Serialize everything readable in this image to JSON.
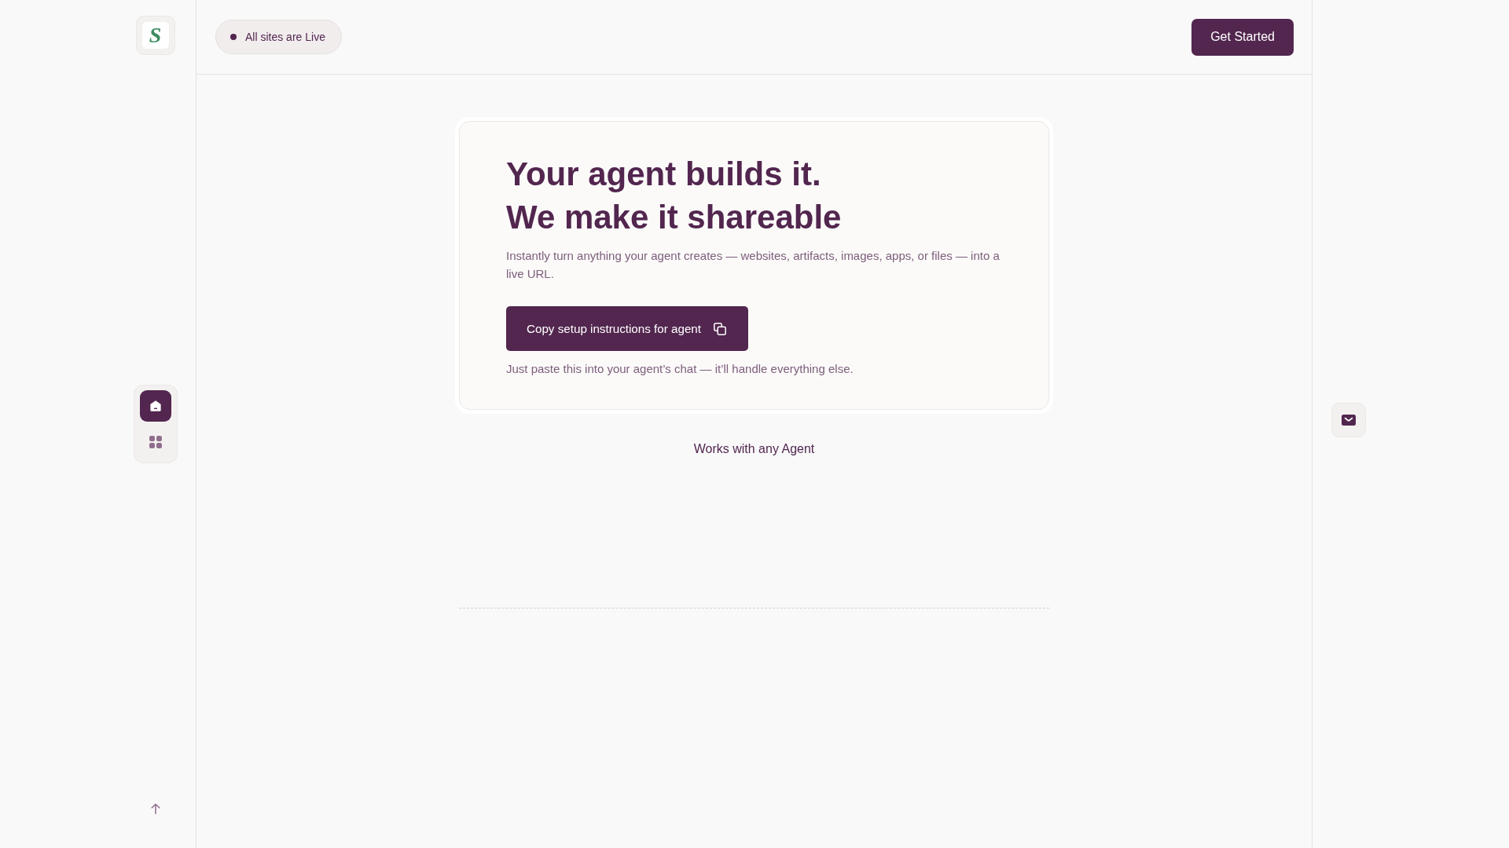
{
  "sidebar": {
    "logo": "S",
    "nav": [
      {
        "kind": "home",
        "selected": true
      },
      {
        "kind": "apps",
        "selected": false
      }
    ]
  },
  "header": {
    "status": "All sites are Live",
    "cta": "Get Started"
  },
  "hero": {
    "title_lines": [
      "Your agent builds it.",
      "We make it shareable"
    ],
    "description": "Instantly turn anything your agent creates — websites, artifacts, images, apps, or files — into a live URL.",
    "action": "Copy setup instructions for agent",
    "note": "Just paste this into your agent’s chat — it’ll handle everything else."
  },
  "works_with": "Works with any Agent"
}
